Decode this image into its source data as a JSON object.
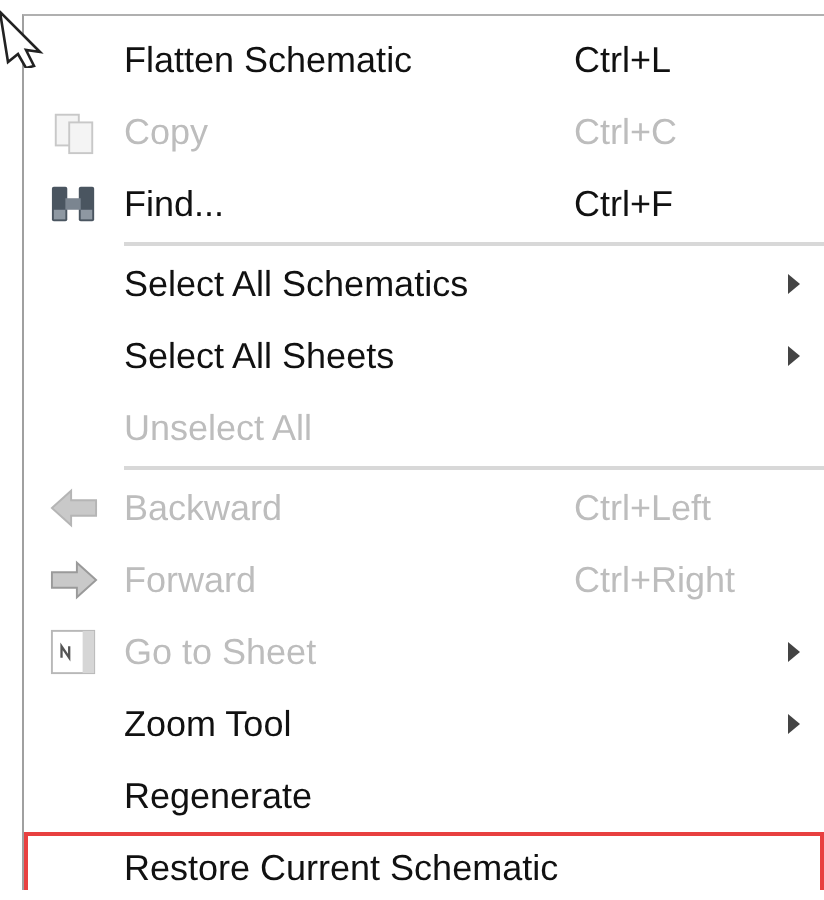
{
  "menu": {
    "items": [
      {
        "kind": "command",
        "label": "Flatten Schematic",
        "shortcut": "Ctrl+L",
        "disabled": false
      },
      {
        "kind": "command",
        "label": "Copy",
        "shortcut": "Ctrl+C",
        "disabled": true
      },
      {
        "kind": "command",
        "label": "Find...",
        "shortcut": "Ctrl+F",
        "disabled": false
      },
      {
        "kind": "separator"
      },
      {
        "kind": "submenu",
        "label": "Select All Schematics",
        "disabled": false
      },
      {
        "kind": "submenu",
        "label": "Select All Sheets",
        "disabled": false
      },
      {
        "kind": "command",
        "label": "Unselect All",
        "disabled": true
      },
      {
        "kind": "separator"
      },
      {
        "kind": "command",
        "label": "Backward",
        "shortcut": "Ctrl+Left",
        "disabled": true
      },
      {
        "kind": "command",
        "label": "Forward",
        "shortcut": "Ctrl+Right",
        "disabled": true
      },
      {
        "kind": "submenu",
        "label": "Go to Sheet",
        "disabled": true
      },
      {
        "kind": "submenu",
        "label": "Zoom Tool",
        "disabled": false
      },
      {
        "kind": "command",
        "label": "Regenerate",
        "disabled": false
      },
      {
        "kind": "command",
        "label": "Restore Current Schematic",
        "disabled": false,
        "highlighted": true
      }
    ]
  }
}
